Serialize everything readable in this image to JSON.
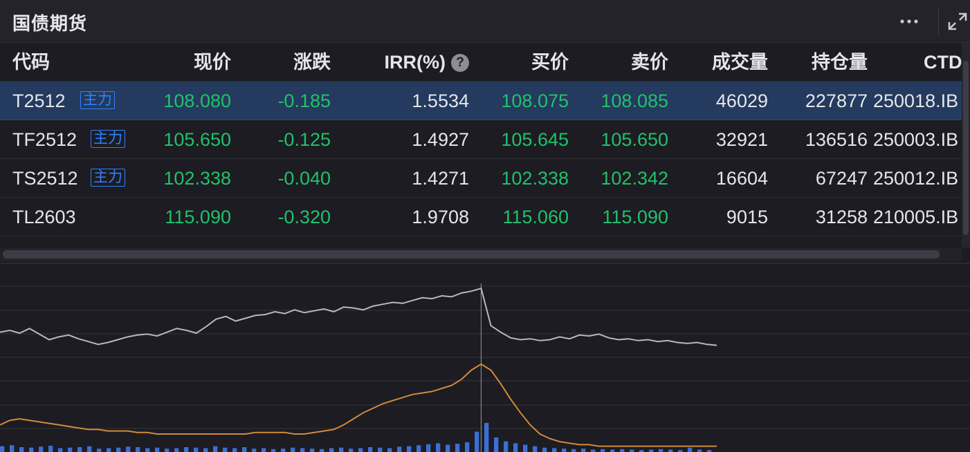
{
  "header": {
    "title": "国债期货",
    "more_icon": "more-horizontal-icon",
    "expand_icon": "expand-icon"
  },
  "table": {
    "columns": {
      "code": "代码",
      "price": "现价",
      "change": "涨跌",
      "irr": "IRR(%)",
      "bid": "买价",
      "ask": "卖价",
      "volume": "成交量",
      "open_interest": "持仓量",
      "ctd": "CTD"
    },
    "irr_help": "?",
    "rows": [
      {
        "code": "T2512",
        "badge": "主力",
        "price": "108.080",
        "change": "-0.185",
        "irr": "1.5534",
        "bid": "108.075",
        "ask": "108.085",
        "volume": "46029",
        "open_interest": "227877",
        "ctd": "250018.IB"
      },
      {
        "code": "TF2512",
        "badge": "主力",
        "price": "105.650",
        "change": "-0.125",
        "irr": "1.4927",
        "bid": "105.645",
        "ask": "105.650",
        "volume": "32921",
        "open_interest": "136516",
        "ctd": "250003.IB"
      },
      {
        "code": "TS2512",
        "badge": "主力",
        "price": "102.338",
        "change": "-0.040",
        "irr": "1.4271",
        "bid": "102.338",
        "ask": "102.342",
        "volume": "16604",
        "open_interest": "67247",
        "ctd": "250012.IB"
      },
      {
        "code": "TL2603",
        "badge": "",
        "price": "115.090",
        "change": "-0.320",
        "irr": "1.9708",
        "bid": "115.060",
        "ask": "115.090",
        "volume": "9015",
        "open_interest": "31258",
        "ctd": "210005.IB"
      }
    ]
  },
  "colors": {
    "down": "#21c16b",
    "badge": "#2f83ff",
    "selected_row": "#243a5e",
    "price_line": "#b8b8c2",
    "avg_line": "#d48a3a",
    "volume_bar": "#3b6fd6"
  },
  "chart_data": {
    "type": "line",
    "series": [
      {
        "values": [
          38,
          40,
          37,
          42,
          36,
          30,
          33,
          35,
          31,
          28,
          25,
          27,
          30,
          33,
          35,
          36,
          34,
          38,
          42,
          40,
          37,
          44,
          52,
          55,
          50,
          53,
          56,
          57,
          60,
          58,
          62,
          59,
          61,
          63,
          60,
          65,
          64,
          62,
          66,
          68,
          70,
          69,
          72,
          75,
          74,
          77,
          76,
          80,
          82,
          85,
          45,
          38,
          32,
          30,
          31,
          29,
          30,
          33,
          31,
          35,
          34,
          36,
          32,
          30,
          31,
          29,
          30,
          28,
          29,
          27,
          26,
          27,
          25,
          24
        ]
      },
      {
        "values": [
          16,
          19,
          20,
          19,
          18,
          17,
          16,
          15,
          14,
          13,
          13,
          12,
          12,
          12,
          11,
          11,
          10,
          10,
          10,
          10,
          10,
          10,
          10,
          10,
          10,
          10,
          11,
          11,
          11,
          11,
          10,
          10,
          11,
          12,
          13,
          16,
          20,
          24,
          27,
          30,
          32,
          34,
          36,
          37,
          38,
          40,
          42,
          46,
          52,
          56,
          52,
          43,
          33,
          24,
          16,
          10,
          7,
          5,
          4,
          3,
          3,
          2,
          2,
          2,
          2,
          2,
          2,
          2,
          2,
          2,
          2,
          2,
          2,
          2
        ]
      },
      {
        "type": "bar",
        "values": [
          12,
          14,
          10,
          9,
          11,
          13,
          8,
          9,
          10,
          12,
          7,
          8,
          9,
          11,
          10,
          8,
          9,
          7,
          8,
          10,
          9,
          8,
          12,
          9,
          8,
          10,
          7,
          8,
          6,
          7,
          9,
          8,
          7,
          6,
          8,
          9,
          7,
          8,
          10,
          9,
          8,
          11,
          12,
          14,
          16,
          18,
          15,
          17,
          20,
          42,
          60,
          30,
          22,
          18,
          15,
          12,
          9,
          8,
          7,
          6,
          7,
          5,
          6,
          5,
          6,
          5,
          4,
          5,
          6,
          5,
          4,
          9,
          5,
          4
        ]
      }
    ],
    "ylim": [
      0,
      100
    ],
    "grid": true
  }
}
